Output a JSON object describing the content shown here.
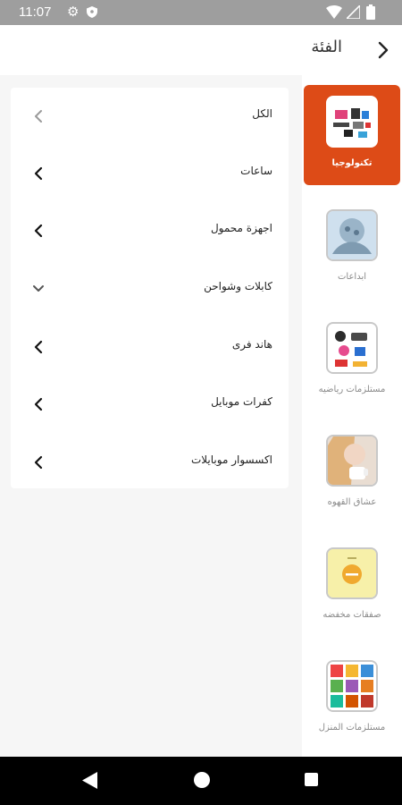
{
  "status_bar": {
    "time": "11:07"
  },
  "header": {
    "title": "الفئة"
  },
  "categories": [
    {
      "label": "تكنولوجيا",
      "active": true
    },
    {
      "label": "ابداعات"
    },
    {
      "label": "مستلزمات رياضيه"
    },
    {
      "label": "عشاق القهوه"
    },
    {
      "label": "صفقات مخفضه"
    },
    {
      "label": "مستلزمات المنزل"
    }
  ],
  "subcategories": [
    {
      "label": "الكل",
      "icon": "chevron-left-icon"
    },
    {
      "label": "ساعات",
      "icon": "chevron-left-icon"
    },
    {
      "label": "اجهزة محمول",
      "icon": "chevron-left-icon"
    },
    {
      "label": "كابلات وشواحن",
      "icon": "chevron-down-icon"
    },
    {
      "label": "هاند فرى",
      "icon": "chevron-left-icon"
    },
    {
      "label": "كفرات موبايل",
      "icon": "chevron-left-icon"
    },
    {
      "label": "اكسسوار موبايلات",
      "icon": "chevron-left-icon"
    }
  ],
  "colors": {
    "accent": "#dd4b17",
    "status_bar": "#9e9e9e",
    "nav_bar": "#000000"
  }
}
